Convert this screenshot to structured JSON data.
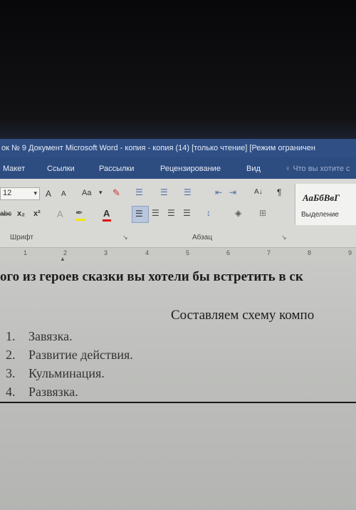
{
  "window": {
    "title": "ок № 9 Документ Microsoft Word - копия - копия (14) [только чтение] [Режим ограничен"
  },
  "ribbon_tabs": [
    {
      "label": "Макет"
    },
    {
      "label": "Ссылки"
    },
    {
      "label": "Рассылки"
    },
    {
      "label": "Рецензирование"
    },
    {
      "label": "Вид"
    }
  ],
  "tell_me": "Что вы хотите с",
  "font": {
    "size_value": "12",
    "grow_label": "A",
    "shrink_label": "A",
    "case_label": "Aa",
    "strike_label": "abc",
    "subscript_label": "x₂",
    "superscript_label": "x²",
    "font_color_label": "A",
    "group_label": "Шрифт"
  },
  "paragraph": {
    "sort_label": "A↓",
    "pilcrow_label": "¶",
    "group_label": "Абзац"
  },
  "styles": {
    "sample_label": "АаБбВвГ",
    "select_label": "Выделение"
  },
  "ruler": {
    "numbers": [
      "1",
      "2",
      "3",
      "4",
      "5",
      "6",
      "7",
      "8",
      "9"
    ]
  },
  "document": {
    "question_line": "ого из героев сказки вы хотели бы встретить в ск",
    "heading": "Составляем схему компо",
    "list_items": [
      {
        "number": "1.",
        "text": "Завязка."
      },
      {
        "number": "2.",
        "text": "Развитие действия."
      },
      {
        "number": "3.",
        "text": "Кульминация."
      },
      {
        "number": "4.",
        "text": "Развязка."
      }
    ]
  }
}
